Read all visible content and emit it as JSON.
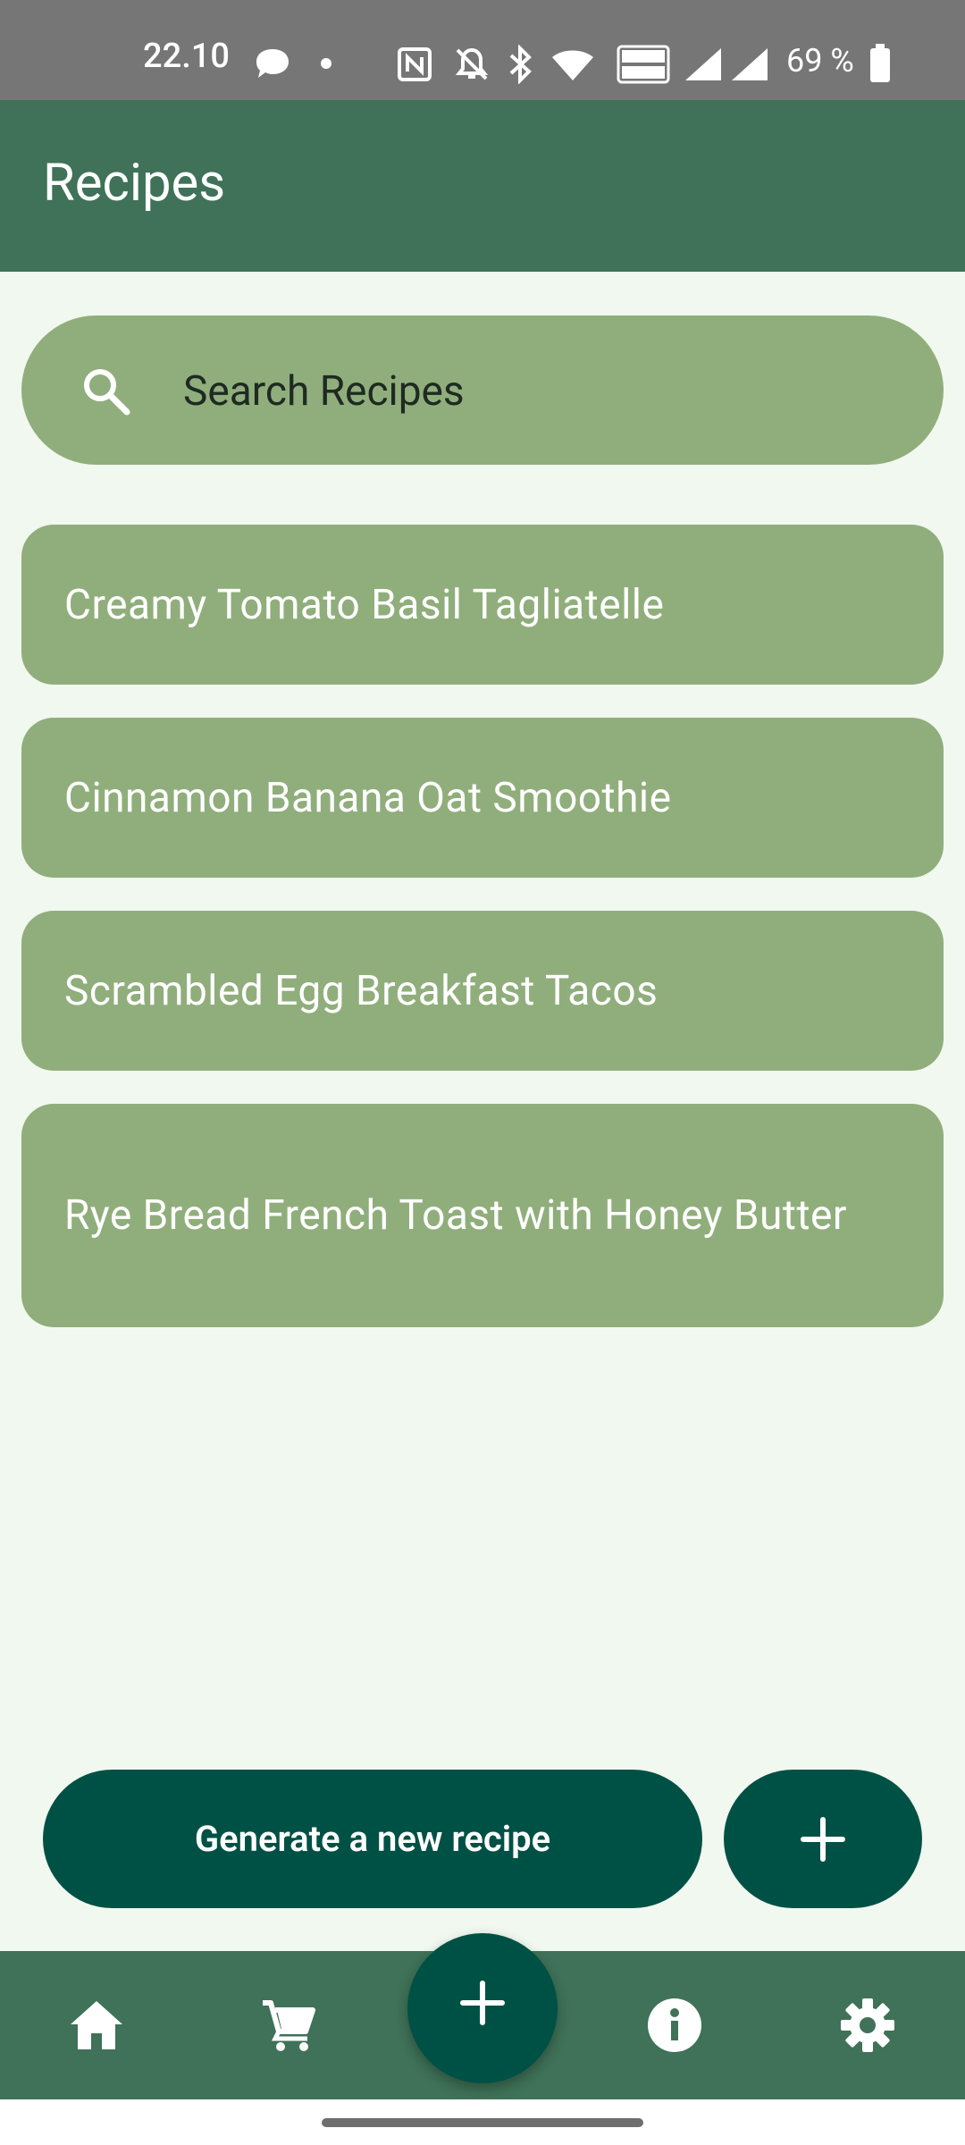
{
  "status_bar": {
    "time": "22.10",
    "battery": "69 %",
    "icons": [
      "chat-bubble-icon",
      "dot-icon",
      "nfc-icon",
      "mute-icon",
      "bluetooth-icon",
      "wifi-icon",
      "vowifi-icon",
      "signal-icon",
      "signal-icon",
      "battery-icon"
    ]
  },
  "app_bar": {
    "title": "Recipes"
  },
  "search": {
    "placeholder": "Search Recipes",
    "icon": "search-icon"
  },
  "recipes": [
    {
      "title": "Creamy Tomato Basil Tagliatelle"
    },
    {
      "title": "Cinnamon Banana Oat Smoothie"
    },
    {
      "title": "Scrambled Egg Breakfast Tacos"
    },
    {
      "title": "Rye Bread French Toast with Honey Butter"
    }
  ],
  "actions": {
    "generate_label": "Generate a new recipe",
    "add_icon": "plus-icon"
  },
  "bottom_nav": {
    "items": [
      {
        "icon": "home-icon"
      },
      {
        "icon": "cart-icon"
      },
      {
        "icon": "plus-icon"
      },
      {
        "icon": "info-icon"
      },
      {
        "icon": "gear-icon"
      }
    ]
  },
  "colors": {
    "status_bar": "#767676",
    "app_bar": "#3F7258",
    "background": "#F1F8EF",
    "card": "#90AE7B",
    "primary_button": "#005145"
  }
}
